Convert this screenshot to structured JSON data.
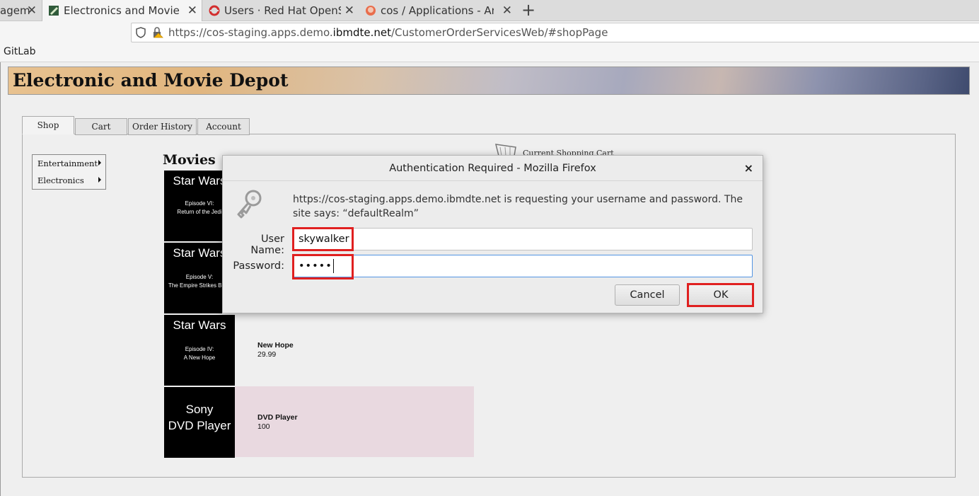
{
  "browser": {
    "tabs": [
      {
        "title": "agem"
      },
      {
        "title": "Electronics and Movie Dep"
      },
      {
        "title": "Users · Red Hat OpenShif"
      },
      {
        "title": "cos / Applications - Argo"
      }
    ],
    "url_prefix": "https://cos-staging.apps.demo.",
    "url_domain": "ibmdte.net",
    "url_suffix": "/CustomerOrderServicesWeb/#shopPage",
    "bookmarks": [
      "GitLab"
    ]
  },
  "page": {
    "banner_title": "Electronic and Movie Depot",
    "tabs": [
      "Shop",
      "Cart",
      "Order History",
      "Account"
    ],
    "menu": [
      "Entertainment",
      "Electronics"
    ],
    "section_heading": "Movies",
    "cart_label": "Current Shopping Cart",
    "products": [
      {
        "poster_title": "Star Wars",
        "poster_sub1": "Episode VI:",
        "poster_sub2": "Return of the Jedi"
      },
      {
        "poster_title": "Star Wars",
        "poster_sub1": "Episode V:",
        "poster_sub2": "The Empire Strikes Back"
      },
      {
        "poster_title": "Star Wars",
        "poster_sub1": "Episode IV:",
        "poster_sub2": "A New Hope",
        "name": "New Hope",
        "price": "29.99"
      },
      {
        "poster_title1": "Sony",
        "poster_title2": "DVD Player",
        "name": "DVD Player",
        "price": "100"
      }
    ]
  },
  "dialog": {
    "title": "Authentication Required - Mozilla Firefox",
    "close": "×",
    "message": "https://cos-staging.apps.demo.ibmdte.net is requesting your username and password. The site says: “defaultRealm”",
    "username_label": "User Name:",
    "username_value": "skywalker",
    "password_label": "Password:",
    "password_value": "•••••",
    "cancel_label": "Cancel",
    "ok_label": "OK",
    "highlight_color": "#e02020"
  }
}
